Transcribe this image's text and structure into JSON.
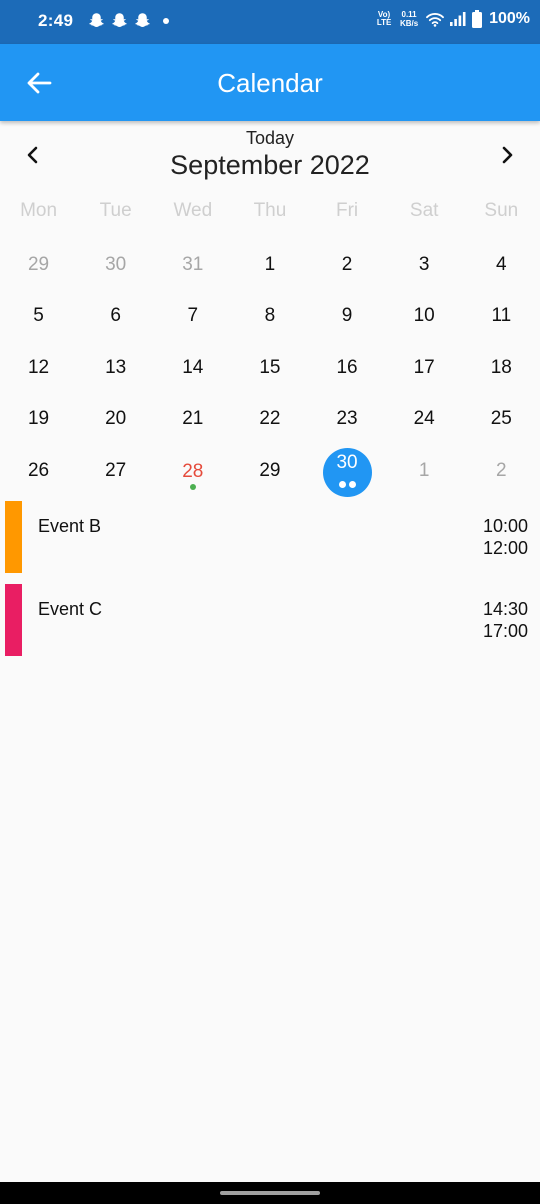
{
  "status_bar": {
    "time": "2:49",
    "notification_icons": [
      "snapchat-icon",
      "snapchat-icon",
      "snapchat-icon",
      "dot-icon"
    ],
    "lte_label_top": "Vo)",
    "lte_label_bottom": "LTE",
    "net_speed_value": "0.11",
    "net_speed_unit": "KB/s",
    "battery_percent": "100%",
    "background_color": "#1c6bb8"
  },
  "app_bar": {
    "title": "Calendar",
    "back_icon": "arrow-left-icon",
    "color": "#2196f3"
  },
  "calendar": {
    "today_label": "Today",
    "month_title": "September 2022",
    "prev_icon": "chevron-left-icon",
    "next_icon": "chevron-right-icon",
    "weekdays": [
      "Mon",
      "Tue",
      "Wed",
      "Thu",
      "Fri",
      "Sat",
      "Sun"
    ],
    "weeks": [
      [
        {
          "day": "29",
          "muted": true
        },
        {
          "day": "30",
          "muted": true
        },
        {
          "day": "31",
          "muted": true
        },
        {
          "day": "1"
        },
        {
          "day": "2"
        },
        {
          "day": "3"
        },
        {
          "day": "4"
        }
      ],
      [
        {
          "day": "5"
        },
        {
          "day": "6"
        },
        {
          "day": "7"
        },
        {
          "day": "8"
        },
        {
          "day": "9"
        },
        {
          "day": "10"
        },
        {
          "day": "11"
        }
      ],
      [
        {
          "day": "12"
        },
        {
          "day": "13"
        },
        {
          "day": "14"
        },
        {
          "day": "15"
        },
        {
          "day": "16"
        },
        {
          "day": "17"
        },
        {
          "day": "18"
        }
      ],
      [
        {
          "day": "19"
        },
        {
          "day": "20"
        },
        {
          "day": "21"
        },
        {
          "day": "22"
        },
        {
          "day": "23"
        },
        {
          "day": "24"
        },
        {
          "day": "25"
        }
      ],
      [
        {
          "day": "26"
        },
        {
          "day": "27"
        },
        {
          "day": "28",
          "today": true,
          "markers": [
            "#4caf50"
          ]
        },
        {
          "day": "29"
        },
        {
          "day": "30",
          "selected": true,
          "markers": [
            "#ffffff",
            "#ffffff"
          ]
        },
        {
          "day": "1",
          "muted": true
        },
        {
          "day": "2",
          "muted": true
        }
      ]
    ],
    "today_color": "#e54b3c",
    "selected_color": "#2196f3"
  },
  "events": [
    {
      "name": "Event B",
      "start": "10:00",
      "end": "12:00",
      "color": "#ff9800"
    },
    {
      "name": "Event C",
      "start": "14:30",
      "end": "17:00",
      "color": "#e91e63"
    }
  ]
}
